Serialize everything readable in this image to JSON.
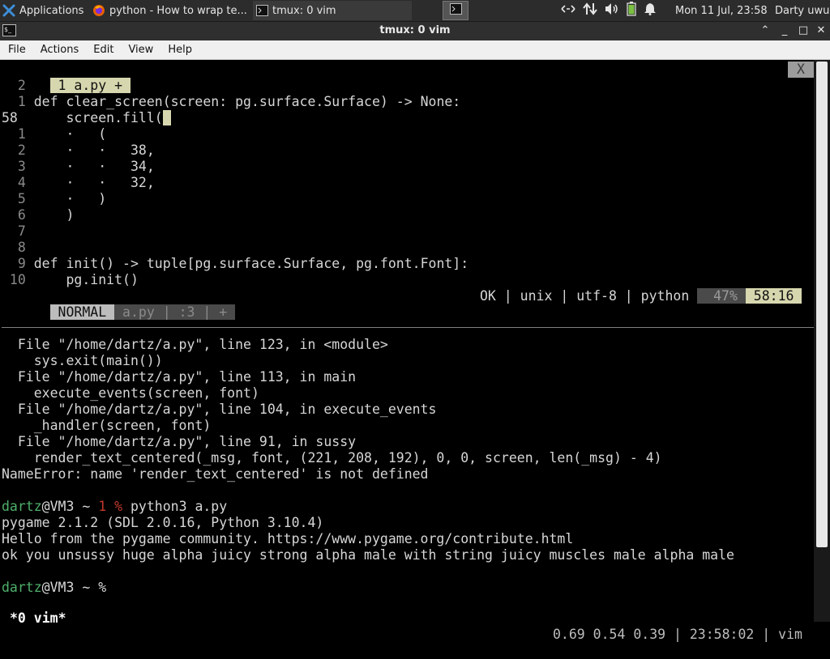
{
  "panel": {
    "applications": "Applications",
    "firefox_task": "python - How to wrap te...",
    "tmux_task": "tmux: 0 vim",
    "clock": "Mon 11 Jul, 23:58",
    "user": "Darty uwu",
    "icons": [
      "network-arrows-icon",
      "transfer-icon",
      "volume-icon",
      "battery-icon",
      "notification-bell-icon"
    ]
  },
  "window": {
    "title": "tmux: 0 vim",
    "minimize": "_",
    "restore": "□",
    "close": "✕",
    "maximize": "⌃"
  },
  "menu": [
    "File",
    "Actions",
    "Edit",
    "View",
    "Help"
  ],
  "vim": {
    "tab_label": " 1 a.py + ",
    "tab_close": "X",
    "lines": [
      {
        "num": "  2",
        "text": ""
      },
      {
        "num": "  1",
        "text": " def clear_screen(screen: pg.surface.Surface) -> None:"
      },
      {
        "num": "58 ",
        "text": "     screen.fill("
      },
      {
        "num": "  1",
        "text": "     ·   ("
      },
      {
        "num": "  2",
        "text": "     ·   ·   38,"
      },
      {
        "num": "  3",
        "text": "     ·   ·   34,"
      },
      {
        "num": "  4",
        "text": "     ·   ·   32,"
      },
      {
        "num": "  5",
        "text": "     ·   )"
      },
      {
        "num": "  6",
        "text": "     )"
      },
      {
        "num": "  7",
        "text": ""
      },
      {
        "num": "  8",
        "text": ""
      },
      {
        "num": "  9",
        "text": " def init() -> tuple[pg.surface.Surface, pg.font.Font]:"
      },
      {
        "num": " 10",
        "text": "     pg.init()"
      }
    ],
    "status": {
      "mode": " NORMAL ",
      "file": " a.py | :3 | + ",
      "info": "OK | unix | utf-8 | python ",
      "percent": "  47% ",
      "position": " 58:16 "
    }
  },
  "shell": {
    "traceback": [
      "  File \"/home/dartz/a.py\", line 123, in <module>",
      "    sys.exit(main())",
      "  File \"/home/dartz/a.py\", line 113, in main",
      "    execute_events(screen, font)",
      "  File \"/home/dartz/a.py\", line 104, in execute_events",
      "    _handler(screen, font)",
      "  File \"/home/dartz/a.py\", line 91, in sussy",
      "    render_text_centered(_msg, font, (221, 208, 192), 0, 0, screen, len(_msg) - 4)",
      "NameError: name 'render_text_centered' is not defined"
    ],
    "prompt1": {
      "user": "dartz",
      "host": "@VM3 ~ ",
      "code": "1 % ",
      "command": "python3 a.py"
    },
    "output": [
      "pygame 2.1.2 (SDL 2.0.16, Python 3.10.4)",
      "Hello from the pygame community. https://www.pygame.org/contribute.html",
      "ok you unsussy huge alpha juicy strong alpha male with string juicy muscles male alpha male"
    ],
    "prompt2": {
      "user": "dartz",
      "host": "@VM3 ~ %"
    }
  },
  "tmux": {
    "window": "*0 vim*",
    "right": "0.69 0.54 0.39 | 23:58:02 | vim"
  }
}
